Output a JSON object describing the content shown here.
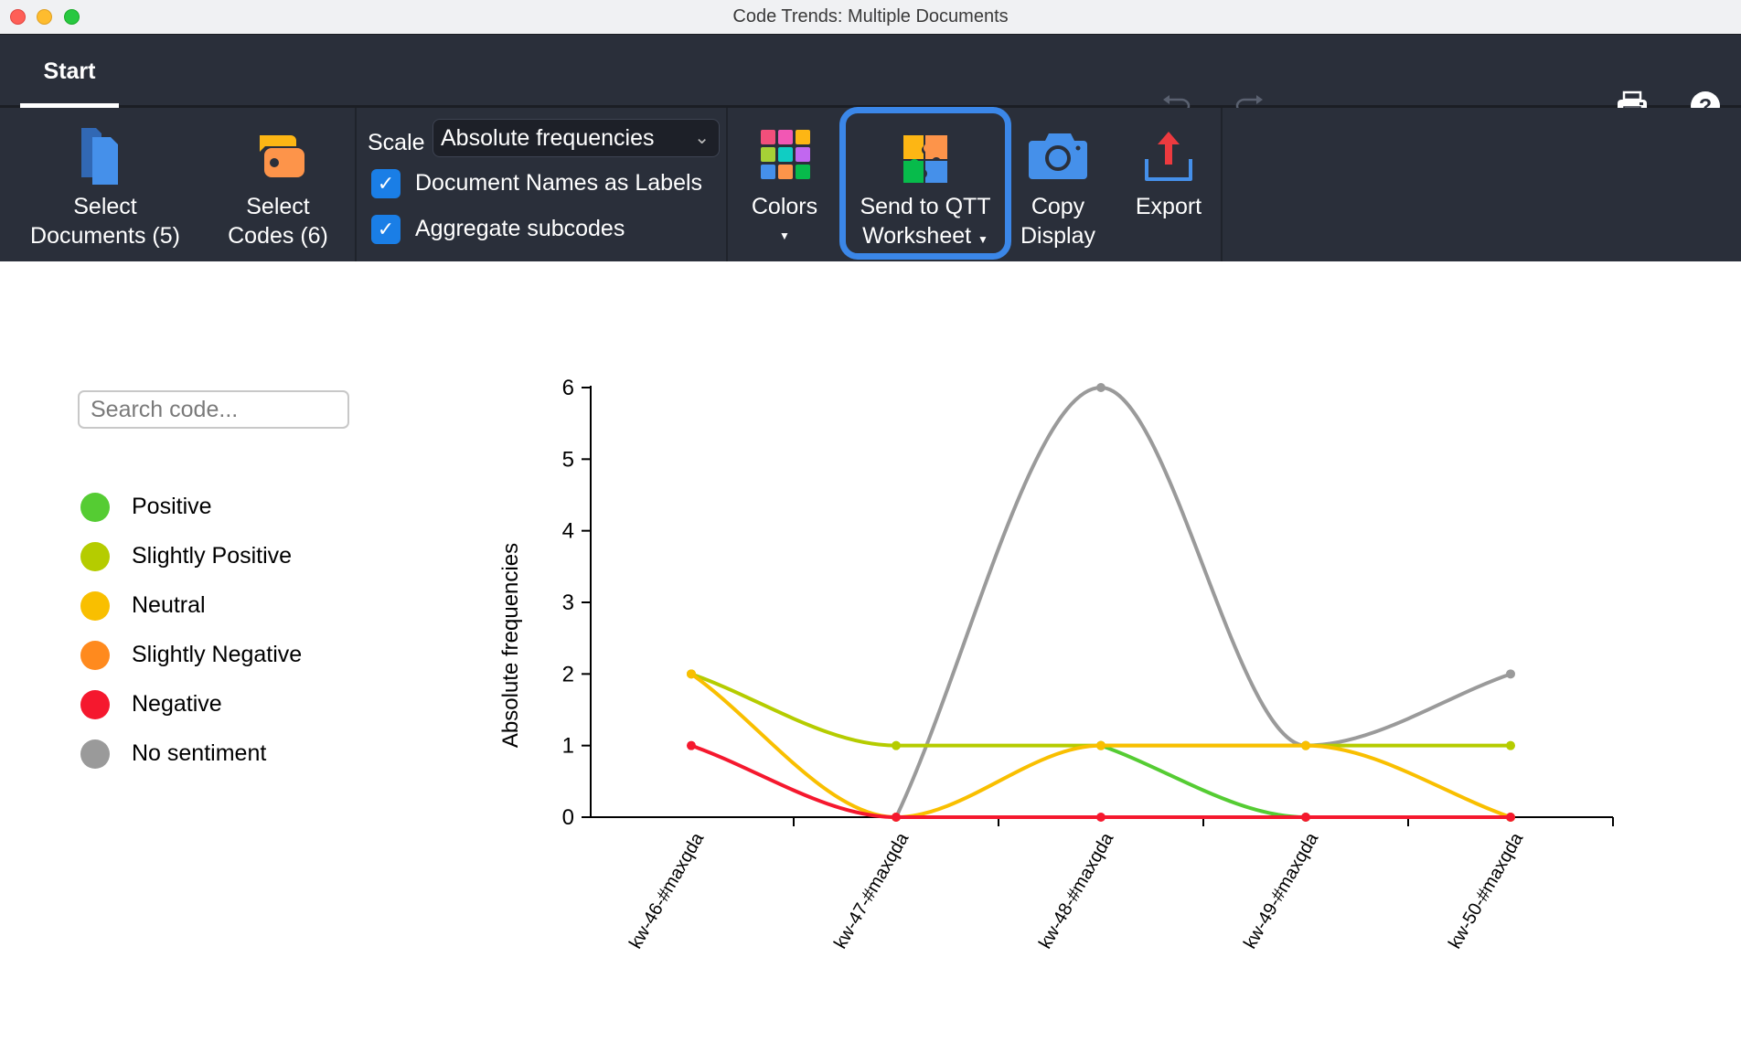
{
  "window": {
    "title": "Code Trends: Multiple Documents"
  },
  "tabs": [
    {
      "label": "Start",
      "active": true
    }
  ],
  "toolbar_top": {
    "undo_icon": "undo-icon",
    "redo_icon": "redo-icon",
    "print_icon": "printer-icon",
    "help_icon": "help-icon"
  },
  "ribbon": {
    "select_documents": {
      "line1": "Select",
      "line2": "Documents (5)",
      "icon": "documents-icon"
    },
    "select_codes": {
      "line1": "Select",
      "line2": "Codes (6)",
      "icon": "codes-tag-icon"
    },
    "scale": {
      "label": "Scale",
      "value": "Absolute frequencies"
    },
    "checkboxes": [
      {
        "label": "Document Names as Labels",
        "checked": true
      },
      {
        "label": "Aggregate subcodes",
        "checked": true
      }
    ],
    "colors": {
      "label": "Colors",
      "icon": "color-grid-icon"
    },
    "send_qtt": {
      "line1": "Send to QTT",
      "line2": "Worksheet",
      "icon": "puzzle-icon"
    },
    "copy_display": {
      "line1": "Copy",
      "line2": "Display",
      "icon": "camera-icon"
    },
    "export": {
      "label": "Export",
      "icon": "export-icon"
    },
    "highlight_color": "#3b87e8"
  },
  "sidebar": {
    "search_placeholder": "Search code...",
    "legend": [
      {
        "label": "Positive",
        "color": "#55cc33"
      },
      {
        "label": "Slightly Positive",
        "color": "#b5cc00"
      },
      {
        "label": "Neutral",
        "color": "#f9bf00"
      },
      {
        "label": "Slightly Negative",
        "color": "#ff8a1e"
      },
      {
        "label": "Negative",
        "color": "#f5182e"
      },
      {
        "label": "No sentiment",
        "color": "#9a9a9a"
      }
    ]
  },
  "chart_data": {
    "type": "line",
    "title": "",
    "xlabel": "",
    "ylabel": "Absolute frequencies",
    "categories": [
      "kw-46-#maxqda",
      "kw-47-#maxqda",
      "kw-48-#maxqda",
      "kw-49-#maxqda",
      "kw-50-#maxqda"
    ],
    "ylim": [
      0,
      6
    ],
    "yticks": [
      "0",
      "1",
      "2",
      "3",
      "4",
      "5",
      "6"
    ],
    "grid": false,
    "smooth": true,
    "series": [
      {
        "name": "No sentiment",
        "color": "#9a9a9a",
        "values": [
          null,
          0,
          6,
          1,
          2
        ]
      },
      {
        "name": "Positive",
        "color": "#55cc33",
        "values": [
          null,
          null,
          1,
          0,
          0
        ]
      },
      {
        "name": "Slightly Positive",
        "color": "#b5cc00",
        "values": [
          2,
          1,
          1,
          1,
          1
        ]
      },
      {
        "name": "Neutral",
        "color": "#f9bf00",
        "values": [
          2,
          0,
          1,
          1,
          0
        ]
      },
      {
        "name": "Negative",
        "color": "#f5182e",
        "values": [
          1,
          0,
          0,
          0,
          0
        ]
      }
    ]
  }
}
